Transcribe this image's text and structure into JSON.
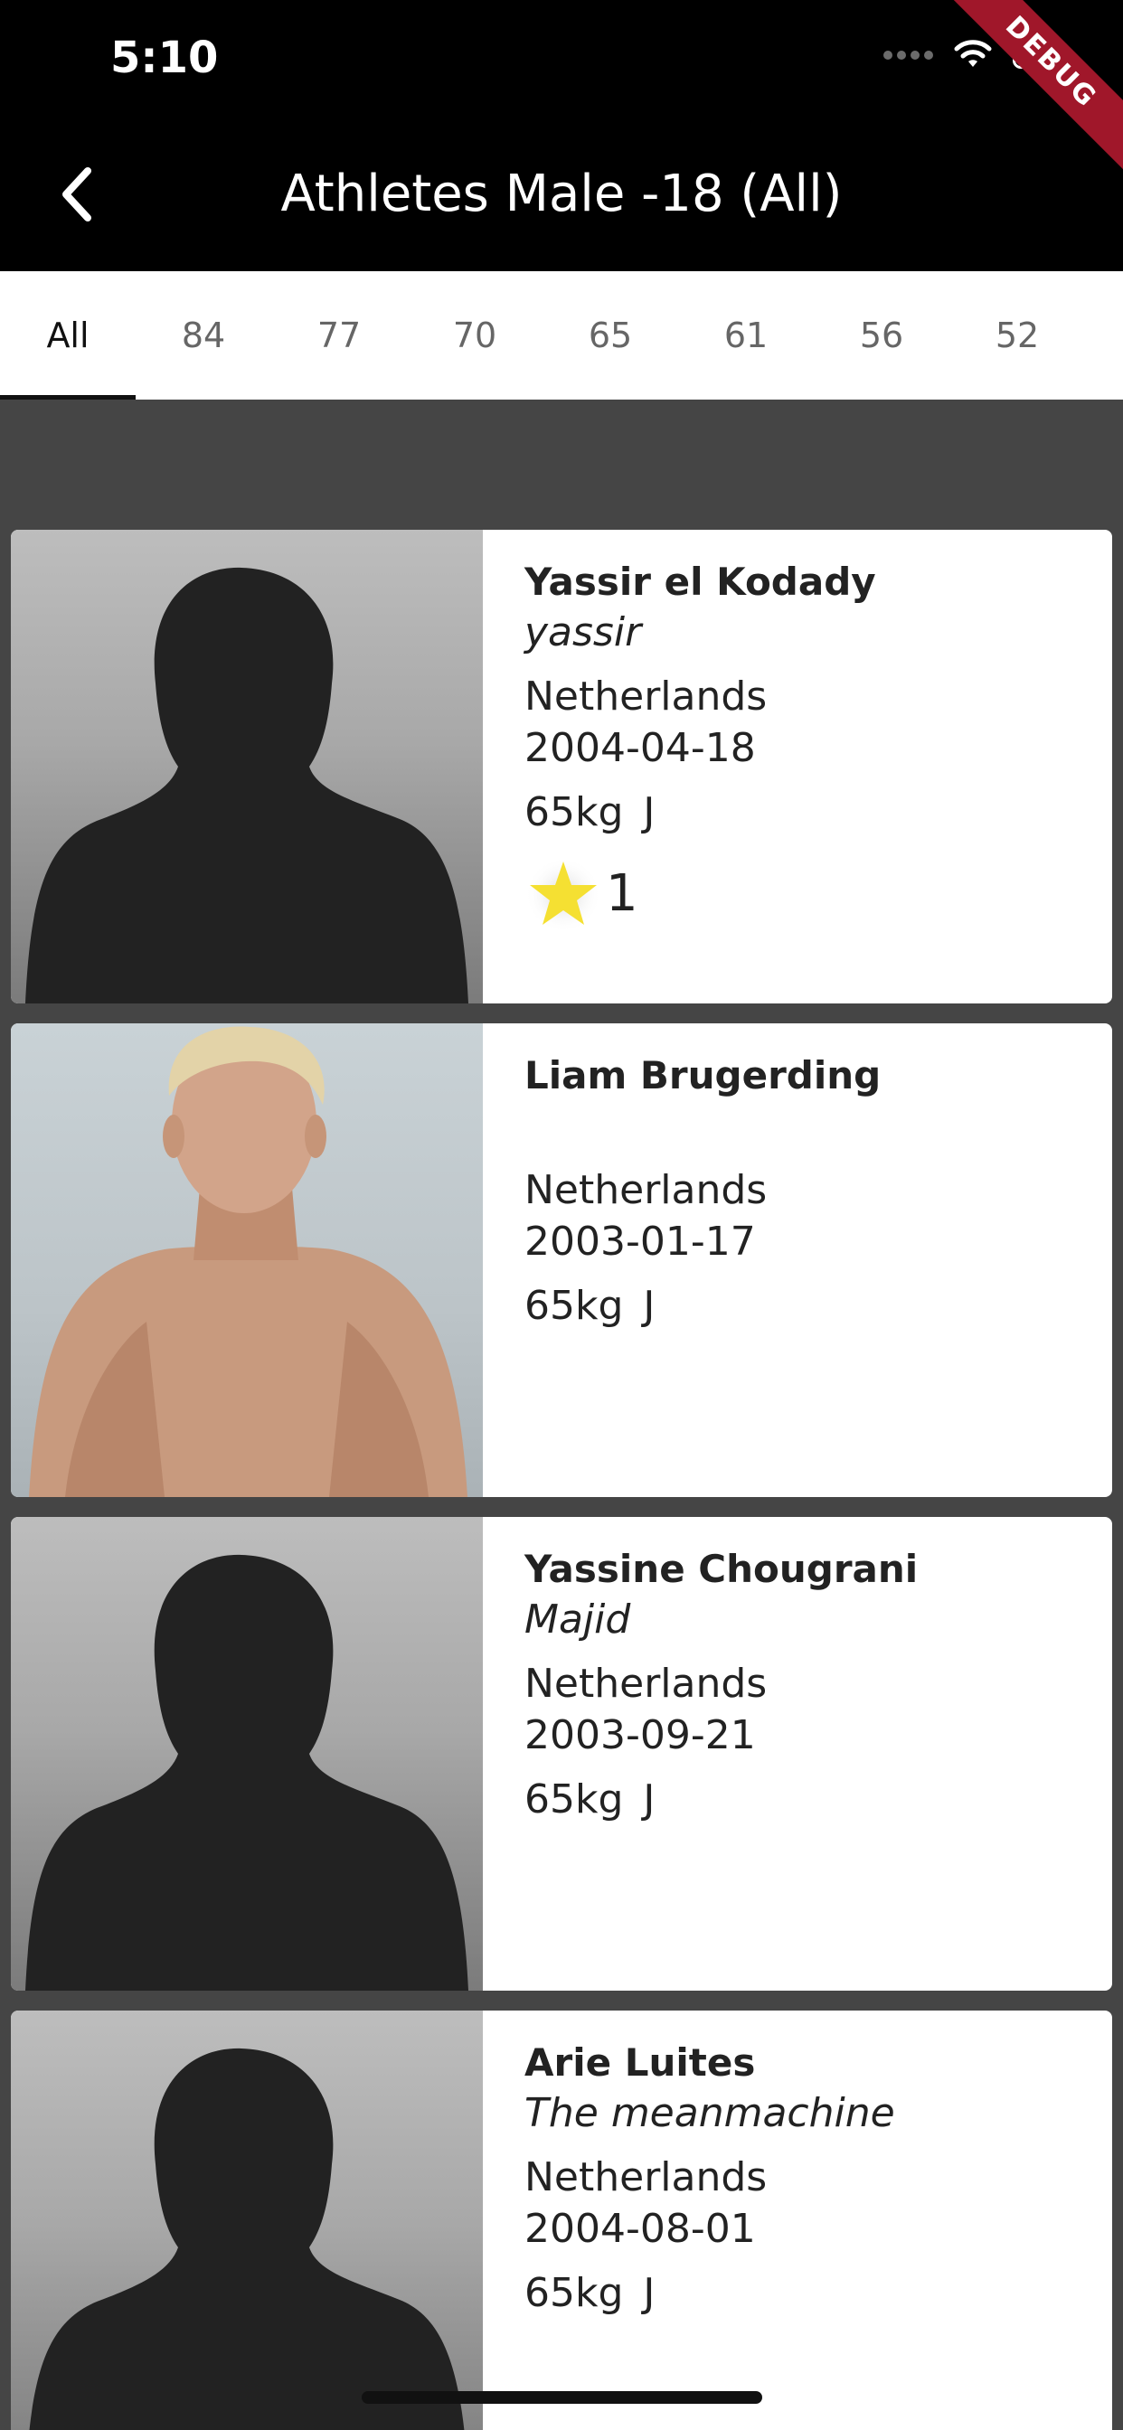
{
  "status_bar": {
    "time": "5:10"
  },
  "debug_banner": "DEBUG",
  "header": {
    "title": "Athletes Male -18 (All)"
  },
  "tabs": [
    {
      "label": "All",
      "active": true
    },
    {
      "label": "84",
      "active": false
    },
    {
      "label": "77",
      "active": false
    },
    {
      "label": "70",
      "active": false
    },
    {
      "label": "65",
      "active": false
    },
    {
      "label": "61",
      "active": false
    },
    {
      "label": "56",
      "active": false
    },
    {
      "label": "52",
      "active": false
    }
  ],
  "athletes": [
    {
      "name": "Yassir el Kodady",
      "nickname": "yassir",
      "country": "Netherlands",
      "dob": "2004-04-18",
      "weight": "65kg",
      "category": "J",
      "stars": "1",
      "photo": "silhouette"
    },
    {
      "name": "Liam Brugerding",
      "nickname": "",
      "country": "Netherlands",
      "dob": "2003-01-17",
      "weight": "65kg",
      "category": "J",
      "photo": "photo"
    },
    {
      "name": "Yassine Chougrani",
      "nickname": "Majid",
      "country": "Netherlands",
      "dob": "2003-09-21",
      "weight": "65kg",
      "category": "J",
      "photo": "silhouette"
    },
    {
      "name": "Arie Luites",
      "nickname": "The meanmachine",
      "country": "Netherlands",
      "dob": "2004-08-01",
      "weight": "65kg",
      "category": "J",
      "photo": "silhouette"
    }
  ],
  "colors": {
    "app_bar": "#000000",
    "background": "#454545",
    "star": "#f5e032",
    "debug_ribbon": "#a0172a"
  }
}
